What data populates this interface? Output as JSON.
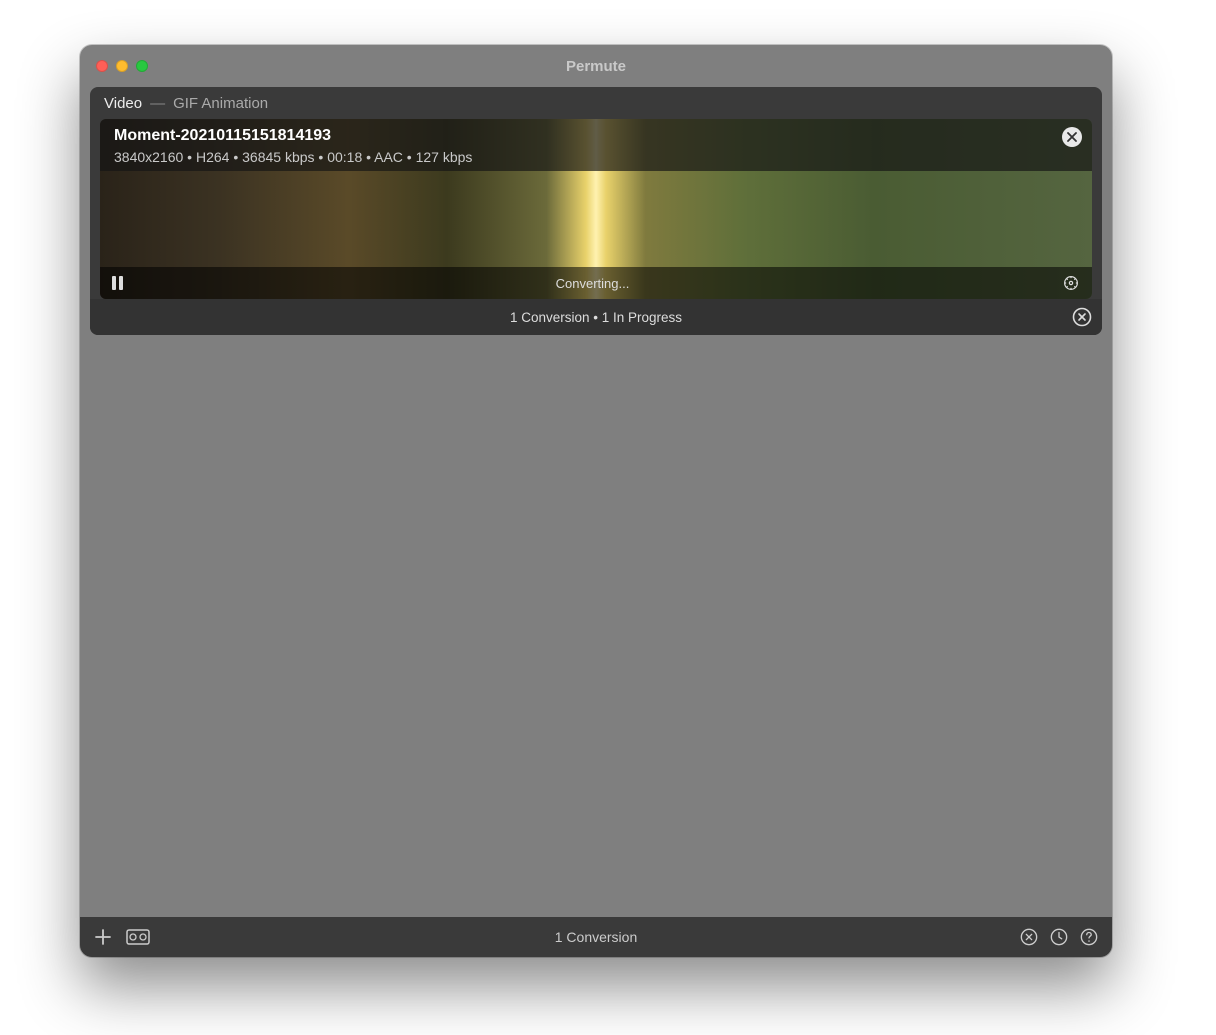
{
  "window": {
    "title": "Permute"
  },
  "group": {
    "category": "Video",
    "preset": "GIF Animation",
    "footer": {
      "text": "1 Conversion  •  1 In Progress"
    }
  },
  "item": {
    "name": "Moment-20210115151814193",
    "meta": "3840x2160  •  H264  •  36845 kbps  •  00:18  •  AAC  •  127 kbps",
    "status": "Converting..."
  },
  "bottombar": {
    "status": "1 Conversion"
  }
}
